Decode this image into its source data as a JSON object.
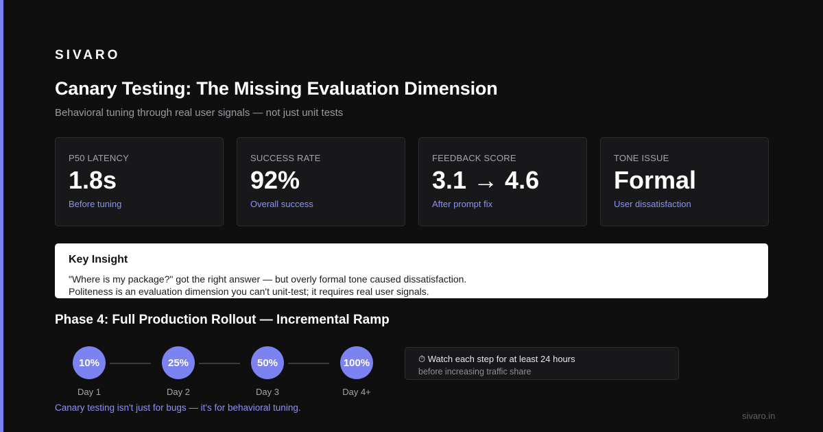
{
  "brand": "SIVARO",
  "title": "Canary Testing: The Missing Evaluation Dimension",
  "subtitle": "Behavioral tuning through real user signals — not just unit tests",
  "metrics": [
    {
      "label": "P50 LATENCY",
      "value": "1.8s",
      "note": "Before tuning"
    },
    {
      "label": "SUCCESS RATE",
      "value": "92%",
      "note": "Overall success"
    },
    {
      "label": "FEEDBACK SCORE",
      "value": "3.1 → 4.6",
      "note": "After prompt fix"
    },
    {
      "label": "TONE ISSUE",
      "value": "Formal",
      "note": "User dissatisfaction"
    }
  ],
  "insight": {
    "title": "Key Insight",
    "line1": "\"Where is my package?\" got the right answer — but overly formal tone caused dissatisfaction.",
    "line2": "Politeness is an evaluation dimension you can't unit-test; it requires real user signals."
  },
  "phase": {
    "title": "Phase 4: Full Production Rollout — Incremental Ramp",
    "steps": [
      {
        "percent": "10%",
        "day": "Day 1"
      },
      {
        "percent": "25%",
        "day": "Day 2"
      },
      {
        "percent": "50%",
        "day": "Day 3"
      },
      {
        "percent": "100%",
        "day": "Day 4+"
      }
    ],
    "watch_main": "⏱ Watch each step for at least 24 hours",
    "watch_sub": "before increasing traffic share"
  },
  "footer_note": "Canary testing isn't just for bugs — it's for behavioral tuning.",
  "site": "sivaro.in",
  "colors": {
    "accent": "#7c83f0",
    "background": "#0f0f10",
    "card": "#18181b",
    "note_text": "#8b92f5"
  }
}
